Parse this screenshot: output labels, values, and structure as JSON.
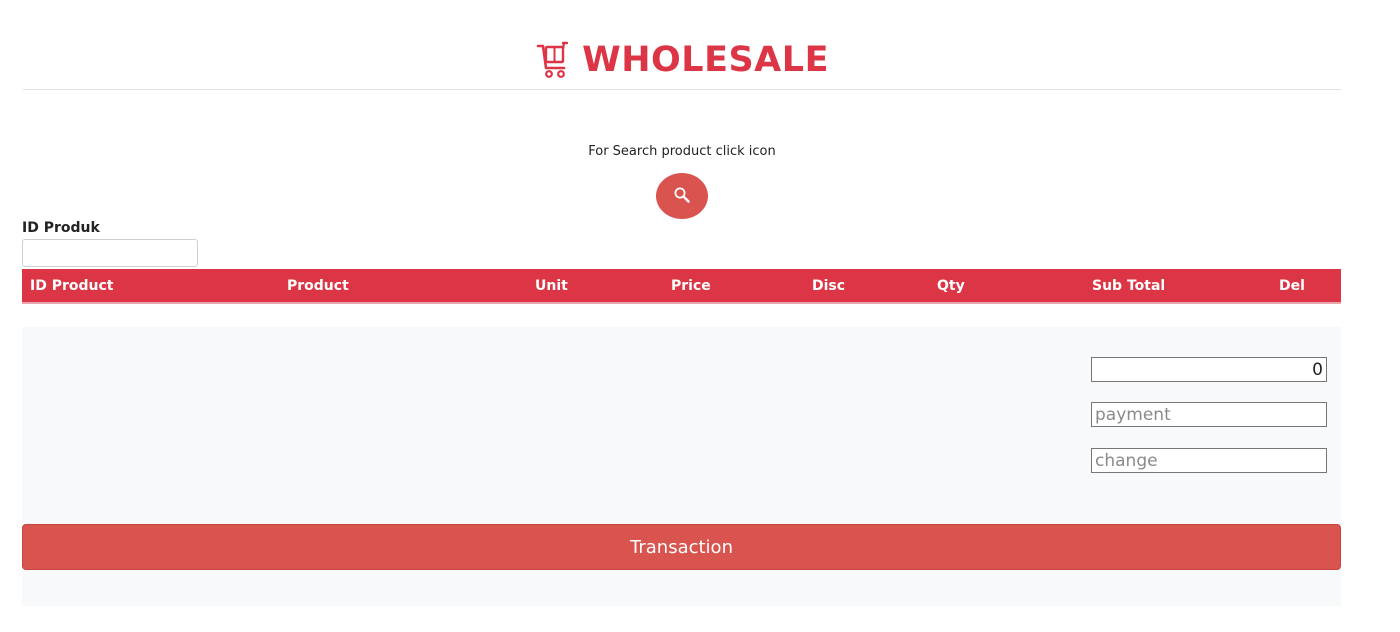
{
  "header": {
    "title": "WHOLESALE",
    "icon": "cart-icon",
    "color": "#dc3545"
  },
  "search": {
    "hint": "For Search product click icon",
    "icon": "search-icon"
  },
  "id_field": {
    "label": "ID Produk",
    "value": ""
  },
  "table": {
    "header_color": "#dc3545",
    "columns": [
      "ID Product",
      "Product",
      "Unit",
      "Price",
      "Disc",
      "Qty",
      "Sub Total",
      "Del"
    ],
    "rows": []
  },
  "totals": {
    "total_value": "0",
    "payment_placeholder": "payment",
    "change_placeholder": "change"
  },
  "actions": {
    "transaction_label": "Transaction",
    "button_color": "#d9534f"
  }
}
